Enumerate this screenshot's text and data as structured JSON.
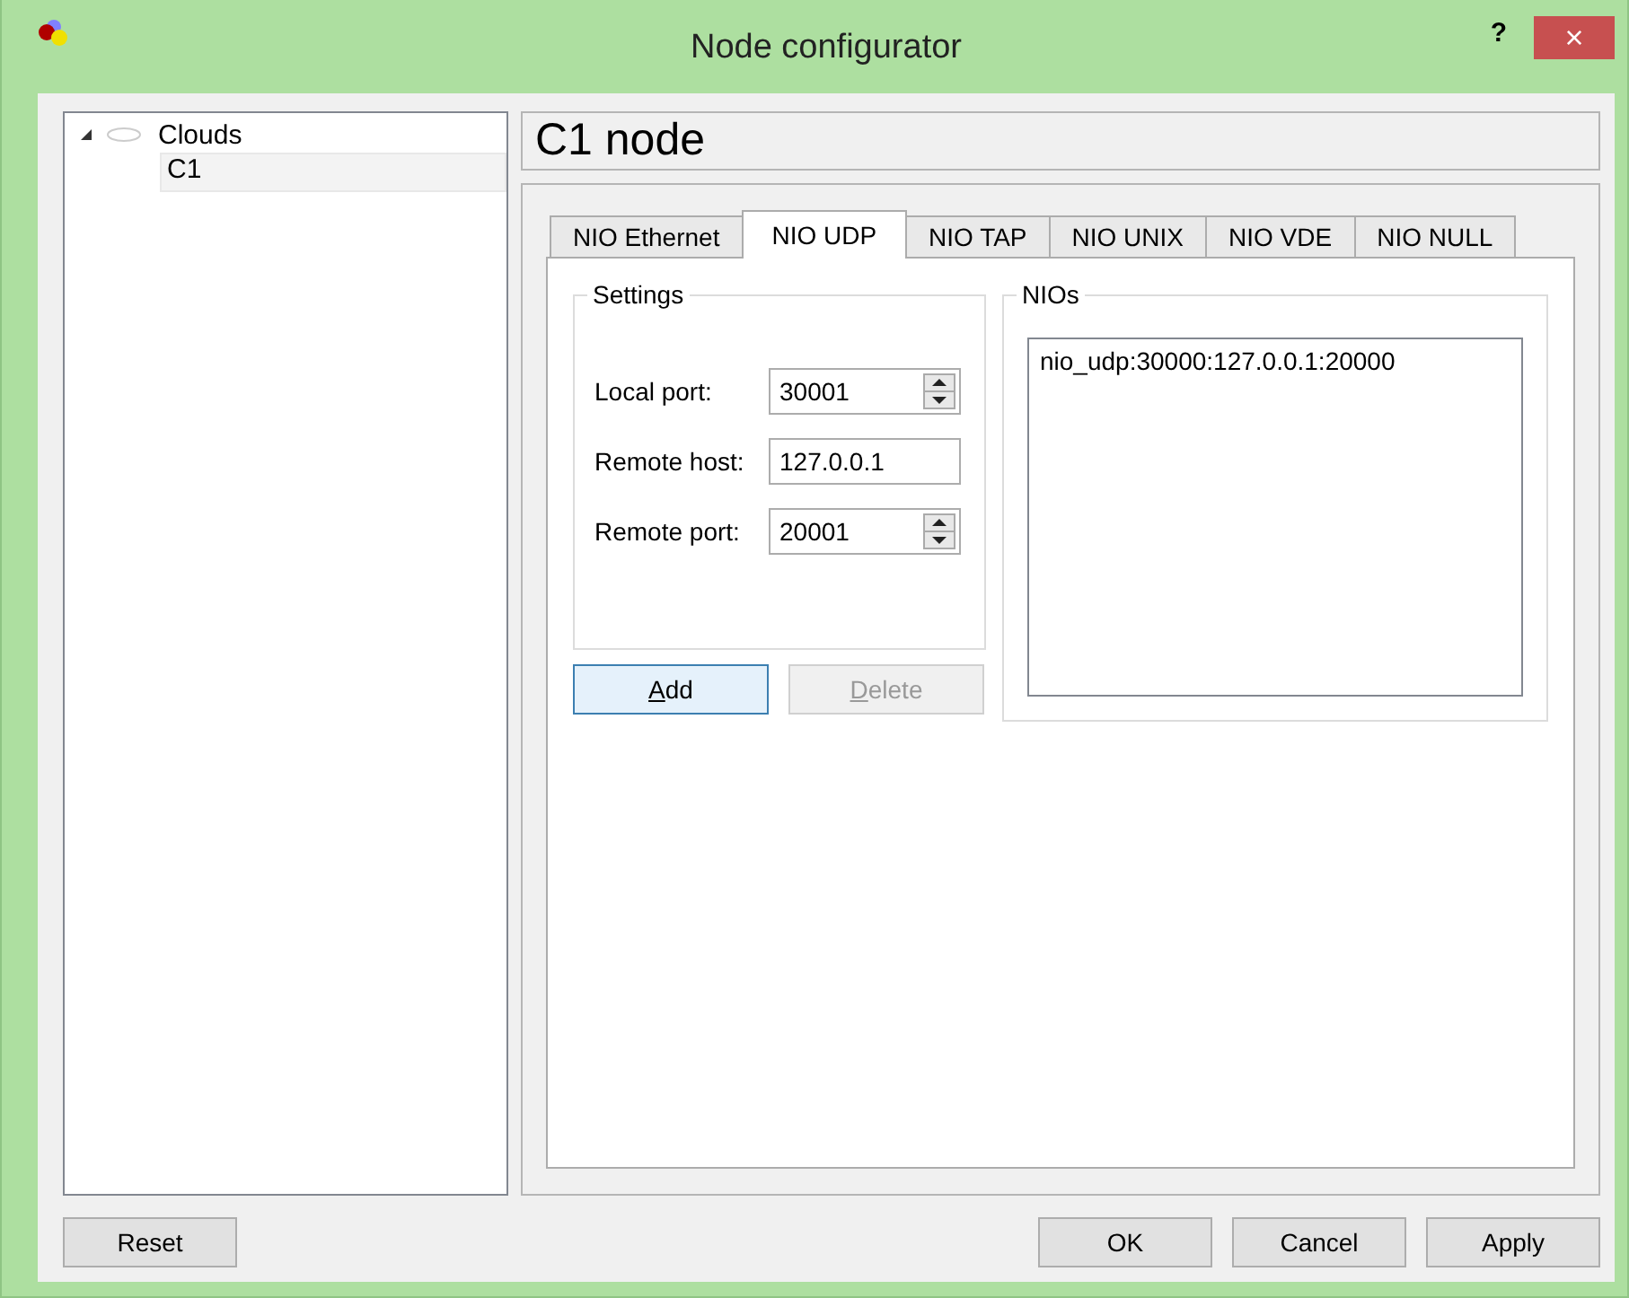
{
  "window": {
    "title": "Node configurator",
    "help": "?",
    "close": "×"
  },
  "tree": [
    {
      "label": "Clouds",
      "expanded": true,
      "selected": false,
      "children": [
        {
          "label": "C1",
          "selected": true
        }
      ]
    }
  ],
  "node_title": "C1 node",
  "tabs": [
    {
      "label": "NIO Ethernet",
      "selected": false
    },
    {
      "label": "NIO UDP",
      "selected": true
    },
    {
      "label": "NIO TAP",
      "selected": false
    },
    {
      "label": "NIO UNIX",
      "selected": false
    },
    {
      "label": "NIO VDE",
      "selected": false
    },
    {
      "label": "NIO NULL",
      "selected": false
    }
  ],
  "settings": {
    "title": "Settings",
    "fields": [
      {
        "label": "Local port:",
        "value": "30001",
        "kind": "spin"
      },
      {
        "label": "Remote host:",
        "value": "127.0.0.1",
        "kind": "text"
      },
      {
        "label": "Remote port:",
        "value": "20001",
        "kind": "spin"
      }
    ]
  },
  "actions": [
    {
      "label": "Add",
      "disabled": false
    },
    {
      "label": "Delete",
      "disabled": true
    }
  ],
  "nios": {
    "title": "NIOs",
    "items": [
      "nio_udp:30000:127.0.0.1:20000"
    ]
  },
  "footer": {
    "left": [
      "Reset"
    ],
    "right": [
      "OK",
      "Cancel",
      "Apply"
    ]
  }
}
